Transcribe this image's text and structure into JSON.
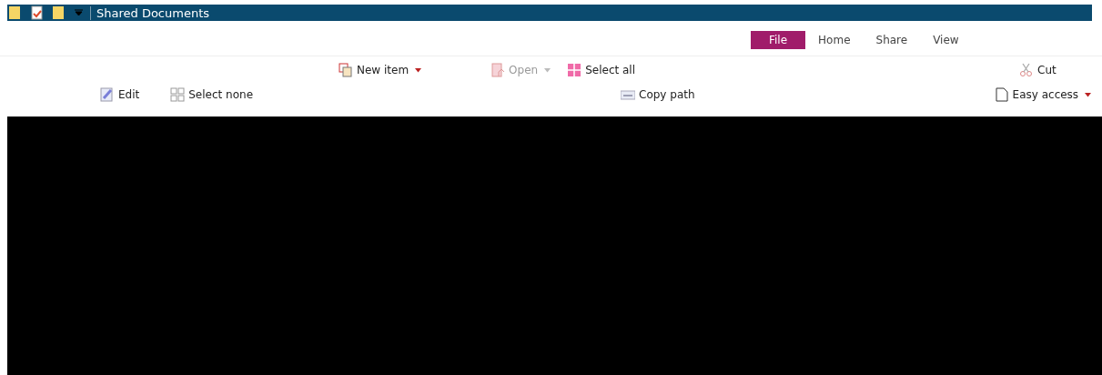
{
  "window": {
    "title": "Shared Documents"
  },
  "tabs": [
    {
      "label": "File",
      "selected": true
    },
    {
      "label": "Home",
      "selected": false
    },
    {
      "label": "Share",
      "selected": false
    },
    {
      "label": "View",
      "selected": false
    }
  ],
  "ribbon": {
    "top_row": [
      {
        "label": "New item",
        "kind": "dropdown",
        "disabled": false
      },
      {
        "label": "Open",
        "kind": "dropdown",
        "disabled": true
      },
      {
        "label": "Select all",
        "kind": "button",
        "disabled": false
      },
      {
        "label": "Cut",
        "kind": "button",
        "disabled": false
      }
    ],
    "bottom_row": [
      {
        "label": "Edit",
        "kind": "button",
        "disabled": false
      },
      {
        "label": "Select none",
        "kind": "button",
        "disabled": false
      },
      {
        "label": "Copy path",
        "kind": "button",
        "disabled": false
      },
      {
        "label": "Easy access",
        "kind": "dropdown",
        "disabled": false
      }
    ]
  }
}
